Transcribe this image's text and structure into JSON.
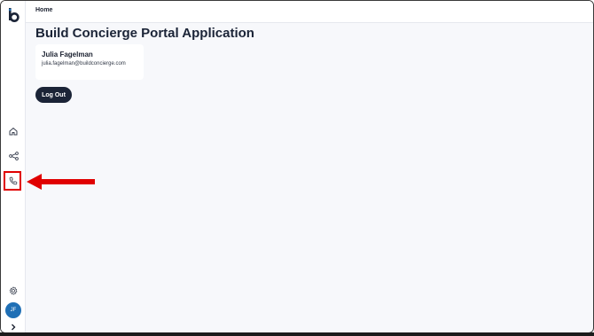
{
  "header": {
    "breadcrumb": "Home"
  },
  "main": {
    "title": "Build Concierge Portal Application",
    "user": {
      "name": "Julia Fagelman",
      "email": "julia.fagelman@buildconcierge.com"
    },
    "logout_label": "Log Out"
  },
  "sidebar": {
    "logo_icon": "b-logo-icon",
    "items": [
      {
        "name": "home",
        "icon": "home-icon"
      },
      {
        "name": "connections",
        "icon": "share-nodes-icon"
      },
      {
        "name": "calls",
        "icon": "phone-icon",
        "highlighted": true
      }
    ],
    "settings_icon": "gear-icon",
    "avatar_initials": "JF",
    "expand_icon": "chevron-right-icon"
  },
  "annotation": {
    "arrow_color": "#e00000",
    "highlight_color": "#e00000"
  },
  "colors": {
    "primary": "#1b2437",
    "avatar_bg": "#1f6fb5",
    "background": "#f7f8fb"
  }
}
